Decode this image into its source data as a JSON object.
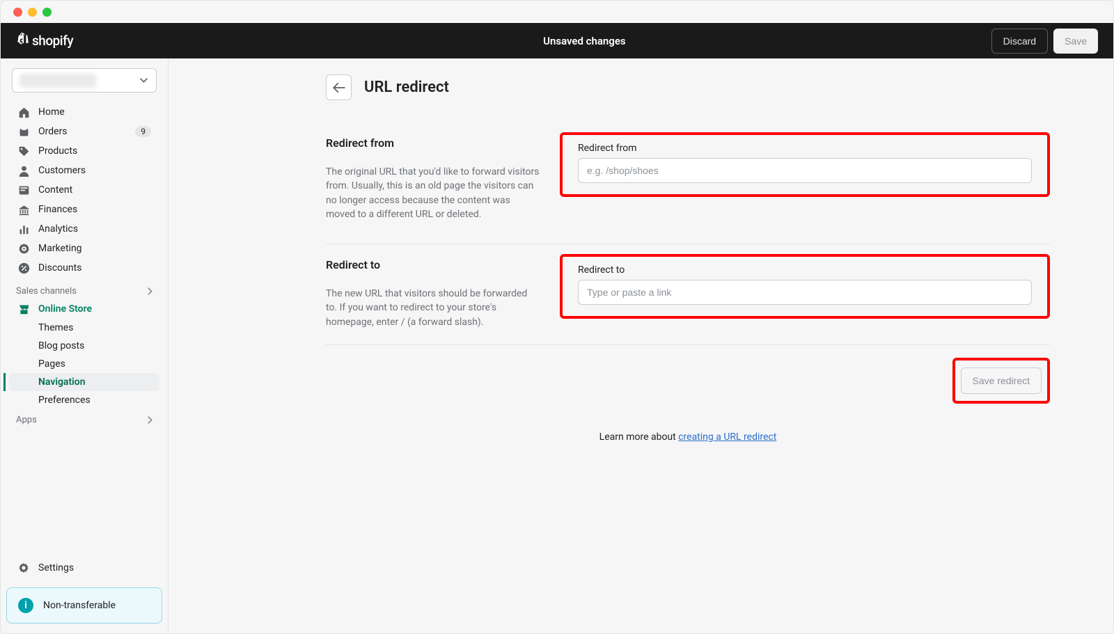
{
  "topbar": {
    "brand": "shopify",
    "status": "Unsaved changes",
    "discard": "Discard",
    "save": "Save"
  },
  "sidebar": {
    "items": [
      {
        "label": "Home"
      },
      {
        "label": "Orders",
        "badge": "9"
      },
      {
        "label": "Products"
      },
      {
        "label": "Customers"
      },
      {
        "label": "Content"
      },
      {
        "label": "Finances"
      },
      {
        "label": "Analytics"
      },
      {
        "label": "Marketing"
      },
      {
        "label": "Discounts"
      }
    ],
    "channelsHeader": "Sales channels",
    "onlineStore": "Online Store",
    "sub": [
      {
        "label": "Themes"
      },
      {
        "label": "Blog posts"
      },
      {
        "label": "Pages"
      },
      {
        "label": "Navigation"
      },
      {
        "label": "Preferences"
      }
    ],
    "appsHeader": "Apps",
    "settings": "Settings",
    "pill": "Non-transferable"
  },
  "page": {
    "title": "URL redirect",
    "section1": {
      "heading": "Redirect from",
      "desc": "The original URL that you'd like to forward visitors from. Usually, this is an old page the visitors can no longer access because the content was moved to a different URL or deleted.",
      "label": "Redirect from",
      "placeholder": "e.g. /shop/shoes"
    },
    "section2": {
      "heading": "Redirect to",
      "desc": "The new URL that visitors should be forwarded to. If you want to redirect to your store's homepage, enter / (a forward slash).",
      "label": "Redirect to",
      "placeholder": "Type or paste a link"
    },
    "saveRedirect": "Save redirect",
    "learnPrefix": "Learn more about ",
    "learnLink": "creating a URL redirect"
  }
}
